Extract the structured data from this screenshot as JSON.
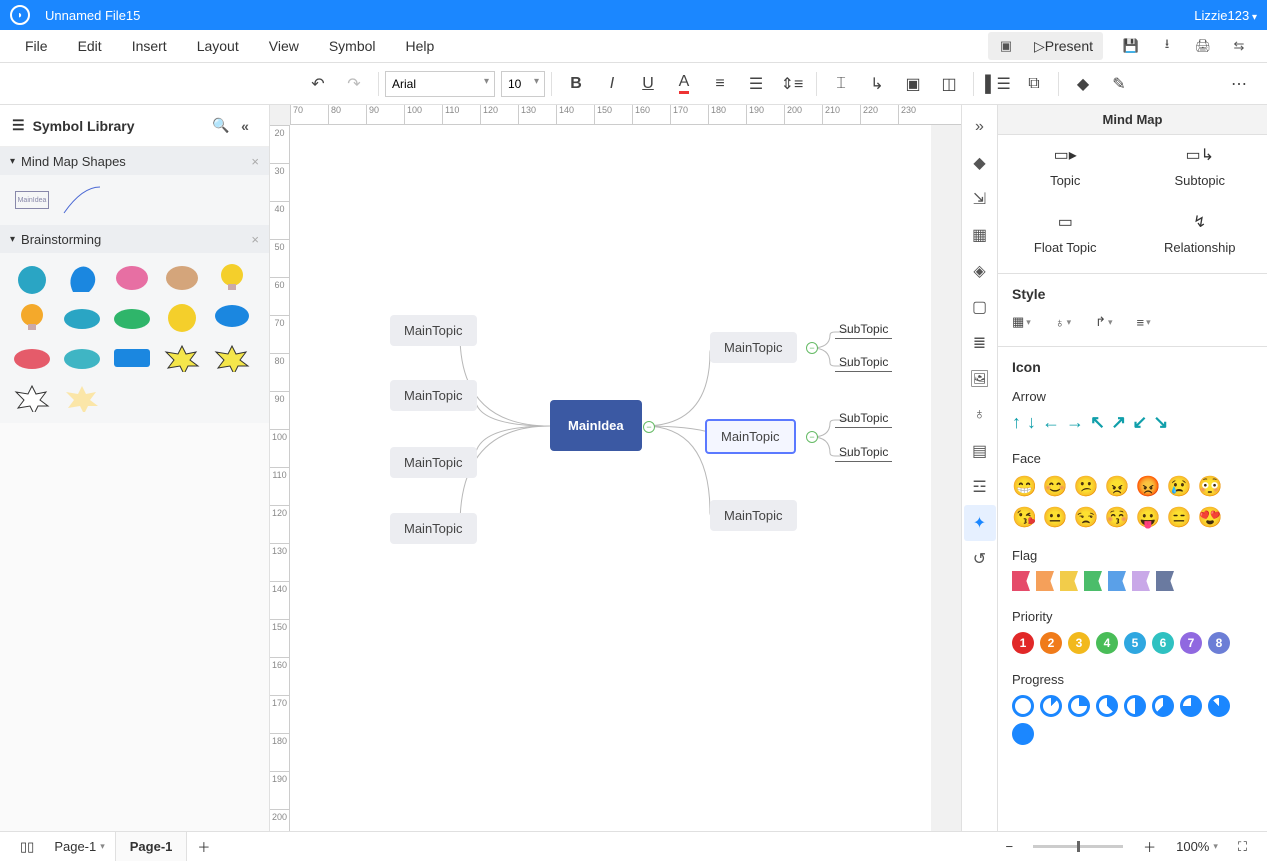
{
  "titlebar": {
    "filename": "Unnamed File15",
    "user": "Lizzie123"
  },
  "menubar": {
    "items": [
      "File",
      "Edit",
      "Insert",
      "Layout",
      "View",
      "Symbol",
      "Help"
    ],
    "present": "Present"
  },
  "toolbar": {
    "font": "Arial",
    "font_size": "10"
  },
  "left_panel": {
    "title": "Symbol Library",
    "sections": [
      {
        "title": "Mind Map Shapes"
      },
      {
        "title": "Brainstorming"
      }
    ]
  },
  "canvas": {
    "hruler": [
      "70",
      "80",
      "90",
      "100",
      "110",
      "120",
      "130",
      "140",
      "150",
      "160",
      "170",
      "180",
      "190",
      "200",
      "210",
      "220",
      "230"
    ],
    "vruler": [
      "20",
      "30",
      "40",
      "50",
      "60",
      "70",
      "80",
      "90",
      "100",
      "110",
      "120",
      "130",
      "140",
      "150",
      "160",
      "170",
      "180",
      "190",
      "200"
    ],
    "main_idea": "MainIdea",
    "main_topics": [
      "MainTopic",
      "MainTopic",
      "MainTopic",
      "MainTopic",
      "MainTopic",
      "MainTopic",
      "MainTopic"
    ],
    "subtopics": [
      "SubTopic",
      "SubTopic",
      "SubTopic",
      "SubTopic"
    ]
  },
  "right_panel": {
    "title": "Mind Map",
    "actions": [
      "Topic",
      "Subtopic",
      "Float Topic",
      "Relationship"
    ],
    "style_title": "Style",
    "icon_title": "Icon",
    "groups": {
      "arrow": "Arrow",
      "face": "Face",
      "flag": "Flag",
      "priority": "Priority",
      "progress": "Progress"
    },
    "priority_values": [
      "1",
      "2",
      "3",
      "4",
      "5",
      "6",
      "7",
      "8"
    ],
    "priority_colors": [
      "#e12828",
      "#f07b1a",
      "#f2b91d",
      "#49bd58",
      "#2fa7e0",
      "#2fc1c1",
      "#9069e0",
      "#6c7ed6"
    ],
    "flag_colors": [
      "#e54b6a",
      "#f5a05a",
      "#f2cc4a",
      "#4bbd6a",
      "#5aa0e8",
      "#c9a8e8",
      "#6a7aa0"
    ],
    "faces": [
      "😁",
      "😊",
      "😕",
      "😠",
      "😡",
      "😢",
      "😳",
      "😘",
      "😐",
      "😒",
      "😚",
      "😛",
      "😑",
      "😍"
    ]
  },
  "statusbar": {
    "page_list": "Page-1",
    "tab": "Page-1",
    "zoom": "100%"
  }
}
